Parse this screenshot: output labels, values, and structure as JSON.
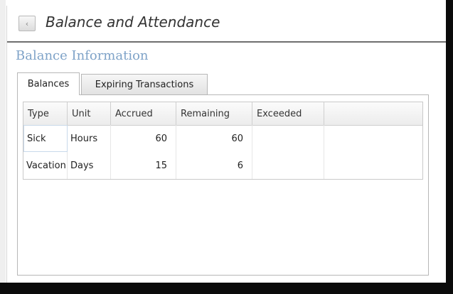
{
  "window": {
    "title": "Balance and Attendance",
    "back_icon": "back-arrow-icon",
    "back_glyph": "‹"
  },
  "section": {
    "title": "Balance Information"
  },
  "tabs": [
    {
      "label": "Balances",
      "active": true
    },
    {
      "label": "Expiring Transactions",
      "active": false
    }
  ],
  "grid": {
    "columns": [
      "Type",
      "Unit",
      "Accrued",
      "Remaining",
      "Exceeded"
    ],
    "rows": [
      {
        "type": "Sick",
        "unit": "Hours",
        "accrued": "60",
        "remaining": "60",
        "exceeded": ""
      },
      {
        "type": "Vacation",
        "unit": "Days",
        "accrued": "15",
        "remaining": "6",
        "exceeded": ""
      }
    ]
  },
  "colors": {
    "section_title": "#7fa3c8",
    "title_underline": "#6e6e6e"
  }
}
